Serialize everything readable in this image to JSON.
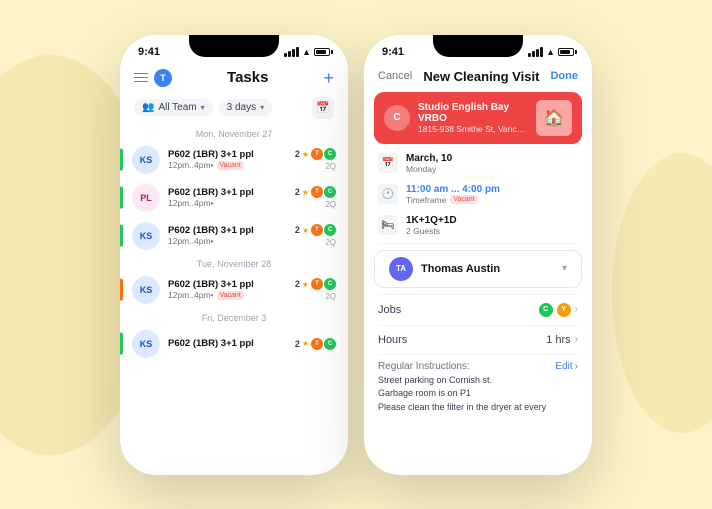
{
  "background": "#fdf3c8",
  "left_phone": {
    "status": {
      "time": "9:41",
      "signal": true,
      "wifi": true,
      "battery": true
    },
    "header": {
      "title": "Tasks",
      "plus": "+",
      "menu_icon": true,
      "t_label": "T"
    },
    "filters": {
      "team_label": "All Team",
      "days_label": "3 days"
    },
    "days": [
      {
        "label": "Mon, November 27",
        "tasks": [
          {
            "avatar": "KS",
            "name": "P602 (1BR) 3+1 ppl",
            "time": "12pm..4pm•",
            "vacant": true,
            "stars": "2",
            "bar": "green"
          },
          {
            "avatar": "PL",
            "name": "P602 (1BR) 3+1 ppl",
            "time": "12pm..4pm•",
            "vacant": false,
            "stars": "2",
            "bar": "green"
          },
          {
            "avatar": "KS",
            "name": "P602 (1BR) 3+1 ppl",
            "time": "12pm..4pm•",
            "vacant": false,
            "stars": "2",
            "bar": "green"
          }
        ]
      },
      {
        "label": "Tue, November 28",
        "tasks": [
          {
            "avatar": "KS",
            "name": "P602 (1BR) 3+1 ppl",
            "time": "12pm..4pm•",
            "vacant": true,
            "stars": "2",
            "bar": "orange"
          }
        ]
      },
      {
        "label": "Fri, December 3",
        "tasks": [
          {
            "avatar": "KS",
            "name": "P602 (1BR) 3+1 ppl",
            "time": "",
            "vacant": false,
            "stars": "2",
            "bar": "green"
          }
        ]
      }
    ]
  },
  "right_phone": {
    "status": {
      "time": "9:41"
    },
    "header": {
      "cancel": "Cancel",
      "title": "New Cleaning Visit",
      "done": "Done"
    },
    "property": {
      "initial": "C",
      "name": "Studio English Bay VRBO",
      "address": "1815-938 Smithe St, Vancouver..."
    },
    "details": {
      "date_main": "March, 10",
      "date_sub": "Monday",
      "time_main": "11:00 am ... 4:00 pm",
      "time_sub": "Timeframe",
      "vacant_label": "Vacant",
      "room_main": "1K+1Q+1D",
      "room_sub": "2 Guests"
    },
    "assignee": {
      "initials": "TA",
      "name": "Thomas Austin"
    },
    "jobs": {
      "label": "Jobs",
      "dot1": "C",
      "dot2": "Y"
    },
    "hours": {
      "label": "Hours",
      "value": "1 hrs"
    },
    "instructions": {
      "label": "Regular Instructions:",
      "edit": "Edit",
      "text": "Street parking on Cornish st.\nGarbage room is on P1\nPlease  clean the filter in the dryer at every"
    }
  }
}
